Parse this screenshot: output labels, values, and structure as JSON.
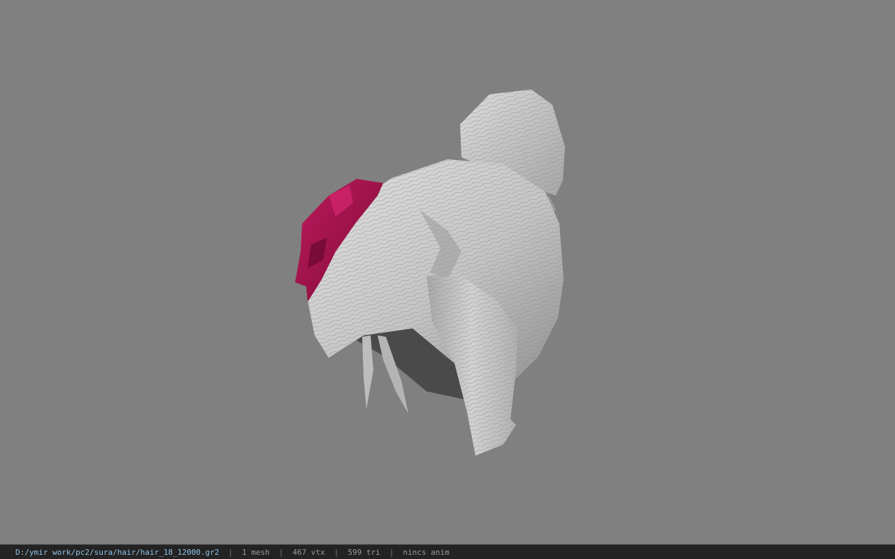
{
  "viewer": {
    "background_color": "#808080",
    "model": {
      "name": "hair-model",
      "primary_color": "#c8c8c8",
      "accent_color": "#a0104a"
    }
  },
  "status_bar": {
    "file_path": "D:/ymir work/pc2/sura/hair/hair_18_12000.gr2",
    "separator": "|",
    "mesh_count": "1 mesh",
    "vertex_count": "467 vtx",
    "triangle_count": "599 tri",
    "animation": "nincs anim"
  }
}
